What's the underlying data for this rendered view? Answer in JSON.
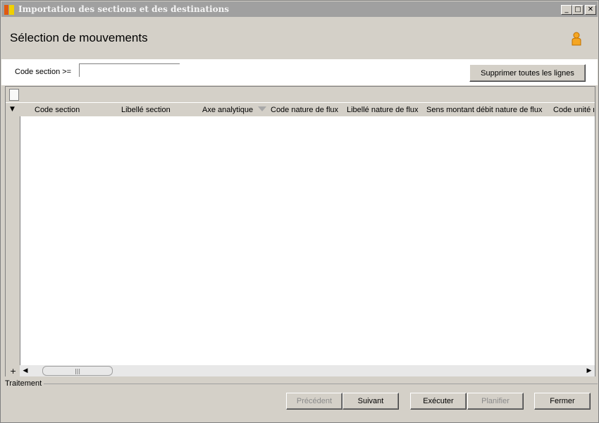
{
  "window": {
    "title": "Importation des sections et des destinations",
    "controls": {
      "minimize": "_",
      "maximize": "□",
      "close": "✕"
    }
  },
  "header": {
    "title": "Sélection de mouvements",
    "icon": "user-icon"
  },
  "filter": {
    "label": "Code section >=",
    "value": "",
    "placeholder": "",
    "clear_button": "Supprimer toutes les lignes"
  },
  "grid": {
    "columns": [
      "Code section",
      "Libellé section",
      "Axe analytique",
      "Code nature de flux",
      "Libellé nature de flux",
      "Sens montant débit nature de flux",
      "Code unité n"
    ],
    "rows": [],
    "add_row": "+",
    "scroll_left": "◀",
    "scroll_right": "▶",
    "scroll_grip": "|||"
  },
  "status": {
    "label": "Traitement"
  },
  "footer": {
    "previous": "Précédent",
    "next": "Suivant",
    "execute": "Exécuter",
    "schedule": "Planifier",
    "close": "Fermer"
  }
}
